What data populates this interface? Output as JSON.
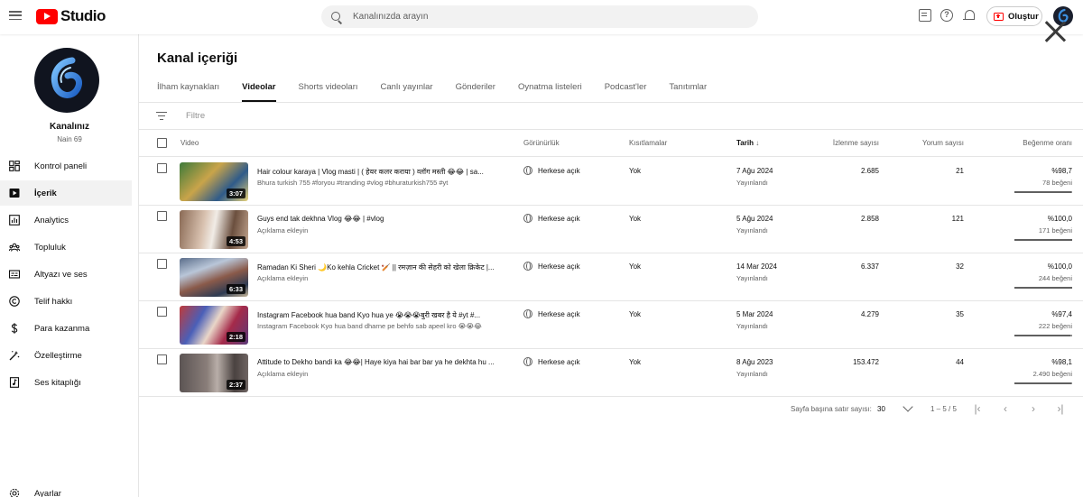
{
  "app": {
    "logo_text": "Studio"
  },
  "header": {
    "search_placeholder": "Kanalınızda arayın",
    "create_label": "Oluştur"
  },
  "sidebar": {
    "channel_name": "Kanalınız",
    "channel_sub": "Nain 69",
    "items": [
      {
        "label": "Kontrol paneli",
        "icon": "dashboard-icon"
      },
      {
        "label": "İçerik",
        "icon": "content-icon",
        "active": true
      },
      {
        "label": "Analytics",
        "icon": "analytics-icon"
      },
      {
        "label": "Topluluk",
        "icon": "community-icon"
      },
      {
        "label": "Altyazı ve ses",
        "icon": "subtitles-icon"
      },
      {
        "label": "Telif hakkı",
        "icon": "copyright-icon"
      },
      {
        "label": "Para kazanma",
        "icon": "monetization-icon"
      },
      {
        "label": "Özelleştirme",
        "icon": "customization-icon"
      },
      {
        "label": "Ses kitaplığı",
        "icon": "audio-library-icon"
      }
    ],
    "settings_label": "Ayarlar"
  },
  "main": {
    "title": "Kanal içeriği",
    "tabs": [
      {
        "label": "İlham kaynakları"
      },
      {
        "label": "Videolar",
        "active": true
      },
      {
        "label": "Shorts videoları"
      },
      {
        "label": "Canlı yayınlar"
      },
      {
        "label": "Gönderiler"
      },
      {
        "label": "Oynatma listeleri"
      },
      {
        "label": "Podcast'ler"
      },
      {
        "label": "Tanıtımlar"
      }
    ],
    "filter_placeholder": "Filtre",
    "columns": {
      "video": "Video",
      "visibility": "Görünürlük",
      "restrictions": "Kısıtlamalar",
      "date": "Tarih",
      "views": "İzlenme sayısı",
      "comments": "Yorum sayısı",
      "likes": "Beğenme oranı"
    },
    "rows": [
      {
        "title": "Hair colour karaya | Vlog masti | ( हेयर कलर कराया ) व्लॉग मस्ती 😂😂 | sa...",
        "description": "Bhura turkish 755 #foryou #tranding #vlog #bhuraturkish755 #yt",
        "duration": "3:07",
        "visibility": "Herkese açık",
        "restrictions": "Yok",
        "date": "7 Ağu 2024",
        "date_status": "Yayınlandı",
        "views": "2.685",
        "comments": "21",
        "like_ratio": "%98,7",
        "likes": "78 beğeni",
        "like_fraction": 0.987
      },
      {
        "title": "Guys end tak dekhna Vlog 😂😂 | #vlog",
        "description": "Açıklama ekleyin",
        "duration": "4:53",
        "visibility": "Herkese açık",
        "restrictions": "Yok",
        "date": "5 Ağu 2024",
        "date_status": "Yayınlandı",
        "views": "2.858",
        "comments": "121",
        "like_ratio": "%100,0",
        "likes": "171 beğeni",
        "like_fraction": 1.0
      },
      {
        "title": "Ramadan Ki Sheri 🌙Ko kehla Cricket 🏏 || रमज़ान की सेहरी को खेला क्रिकेट |...",
        "description": "Açıklama ekleyin",
        "duration": "6:33",
        "visibility": "Herkese açık",
        "restrictions": "Yok",
        "date": "14 Mar 2024",
        "date_status": "Yayınlandı",
        "views": "6.337",
        "comments": "32",
        "like_ratio": "%100,0",
        "likes": "244 beğeni",
        "like_fraction": 1.0
      },
      {
        "title": "Instagram Facebook hua band Kyo hua ye 😭😭😭बुरी खबर है ये #yt #...",
        "description": "Instagram Facebook Kyo hua band dharne pe behfo sab apeel kro 😭😭😂",
        "duration": "2:18",
        "visibility": "Herkese açık",
        "restrictions": "Yok",
        "date": "5 Mar 2024",
        "date_status": "Yayınlandı",
        "views": "4.279",
        "comments": "35",
        "like_ratio": "%97,4",
        "likes": "222 beğeni",
        "like_fraction": 0.974
      },
      {
        "title": "Attitude to Dekho bandi ka 😂😂| Haye kiya hai bar bar ya he dekhta hu ...",
        "description": "Açıklama ekleyin",
        "duration": "2:37",
        "visibility": "Herkese açık",
        "restrictions": "Yok",
        "date": "8 Ağu 2023",
        "date_status": "Yayınlandı",
        "views": "153.472",
        "comments": "44",
        "like_ratio": "%98,1",
        "likes": "2.490 beğeni",
        "like_fraction": 0.981
      }
    ],
    "pagination": {
      "rows_per_page_label": "Sayfa başına satır sayısı:",
      "rows_per_page": "30",
      "range": "1 – 5 / 5"
    }
  },
  "colors": {
    "brand": "#ff0000",
    "text": "#0f0f0f",
    "secondary": "#606060"
  }
}
